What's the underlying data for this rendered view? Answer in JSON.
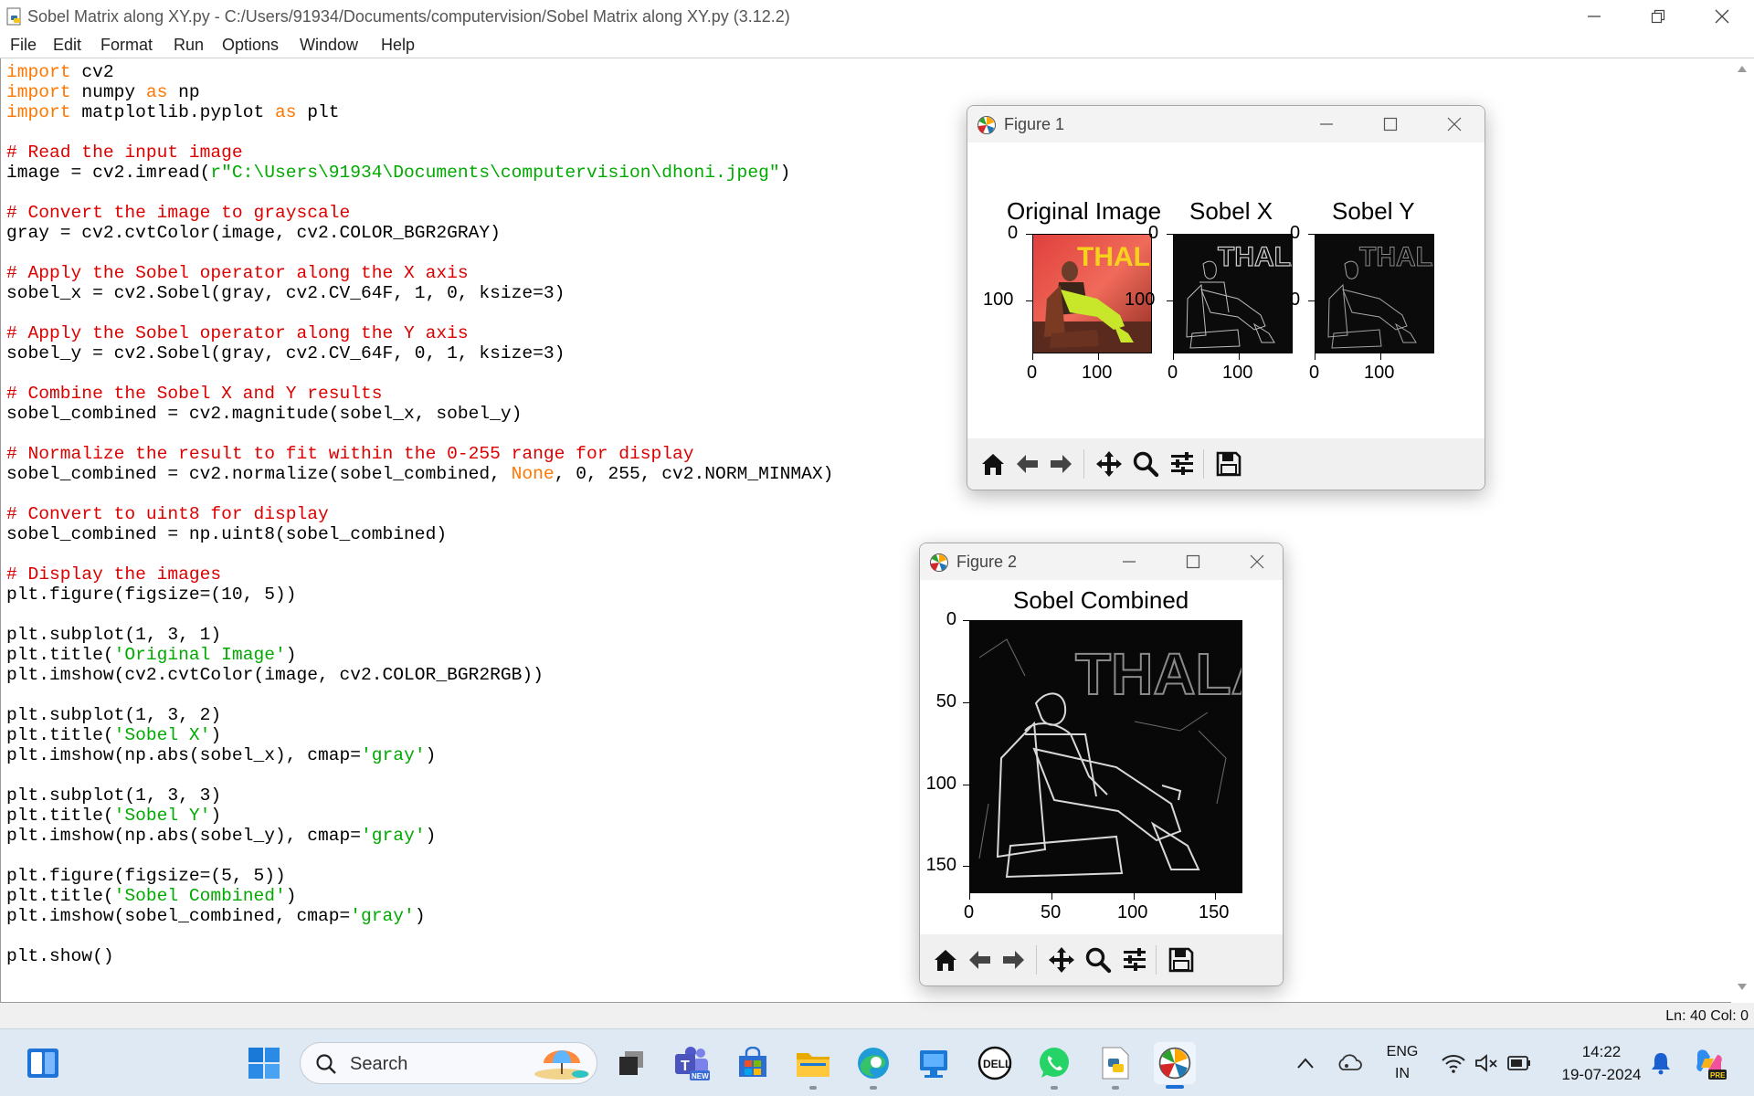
{
  "window": {
    "title": "Sobel Matrix along XY.py - C:/Users/91934/Documents/computervision/Sobel Matrix along XY.py (3.12.2)",
    "icon": "python-file-icon"
  },
  "menu": [
    "File",
    "Edit",
    "Format",
    "Run",
    "Options",
    "Window",
    "Help"
  ],
  "code": [
    [
      [
        "kw",
        "import"
      ],
      [
        "t",
        " cv2"
      ]
    ],
    [
      [
        "kw",
        "import"
      ],
      [
        "t",
        " numpy "
      ],
      [
        "kw",
        "as"
      ],
      [
        "t",
        " np"
      ]
    ],
    [
      [
        "kw",
        "import"
      ],
      [
        "t",
        " matplotlib.pyplot "
      ],
      [
        "kw",
        "as"
      ],
      [
        "t",
        " plt"
      ]
    ],
    [],
    [
      [
        "cm",
        "# Read the input image"
      ]
    ],
    [
      [
        "t",
        "image = cv2.imread("
      ],
      [
        "st",
        "r\"C:\\Users\\91934\\Documents\\computervision\\dhoni.jpeg\""
      ],
      [
        "t",
        ")"
      ]
    ],
    [],
    [
      [
        "cm",
        "# Convert the image to grayscale"
      ]
    ],
    [
      [
        "t",
        "gray = cv2.cvtColor(image, cv2.COLOR_BGR2GRAY)"
      ]
    ],
    [],
    [
      [
        "cm",
        "# Apply the Sobel operator along the X axis"
      ]
    ],
    [
      [
        "t",
        "sobel_x = cv2.Sobel(gray, cv2.CV_64F, 1, 0, ksize=3)"
      ]
    ],
    [],
    [
      [
        "cm",
        "# Apply the Sobel operator along the Y axis"
      ]
    ],
    [
      [
        "t",
        "sobel_y = cv2.Sobel(gray, cv2.CV_64F, 0, 1, ksize=3)"
      ]
    ],
    [],
    [
      [
        "cm",
        "# Combine the Sobel X and Y results"
      ]
    ],
    [
      [
        "t",
        "sobel_combined = cv2.magnitude(sobel_x, sobel_y)"
      ]
    ],
    [],
    [
      [
        "cm",
        "# Normalize the result to fit within the 0-255 range for display"
      ]
    ],
    [
      [
        "t",
        "sobel_combined = cv2.normalize(sobel_combined, "
      ],
      [
        "kw",
        "None"
      ],
      [
        "t",
        ", 0, 255, cv2.NORM_MINMAX)"
      ]
    ],
    [],
    [
      [
        "cm",
        "# Convert to uint8 for display"
      ]
    ],
    [
      [
        "t",
        "sobel_combined = np.uint8(sobel_combined)"
      ]
    ],
    [],
    [
      [
        "cm",
        "# Display the images"
      ]
    ],
    [
      [
        "t",
        "plt.figure(figsize=(10, 5))"
      ]
    ],
    [],
    [
      [
        "t",
        "plt.subplot(1, 3, 1)"
      ]
    ],
    [
      [
        "t",
        "plt.title("
      ],
      [
        "st",
        "'Original Image'"
      ],
      [
        "t",
        ")"
      ]
    ],
    [
      [
        "t",
        "plt.imshow(cv2.cvtColor(image, cv2.COLOR_BGR2RGB))"
      ]
    ],
    [],
    [
      [
        "t",
        "plt.subplot(1, 3, 2)"
      ]
    ],
    [
      [
        "t",
        "plt.title("
      ],
      [
        "st",
        "'Sobel X'"
      ],
      [
        "t",
        ")"
      ]
    ],
    [
      [
        "t",
        "plt.imshow(np.abs(sobel_x), cmap="
      ],
      [
        "st",
        "'gray'"
      ],
      [
        "t",
        ")"
      ]
    ],
    [],
    [
      [
        "t",
        "plt.subplot(1, 3, 3)"
      ]
    ],
    [
      [
        "t",
        "plt.title("
      ],
      [
        "st",
        "'Sobel Y'"
      ],
      [
        "t",
        ")"
      ]
    ],
    [
      [
        "t",
        "plt.imshow(np.abs(sobel_y), cmap="
      ],
      [
        "st",
        "'gray'"
      ],
      [
        "t",
        ")"
      ]
    ],
    [],
    [
      [
        "t",
        "plt.figure(figsize=(5, 5))"
      ]
    ],
    [
      [
        "t",
        "plt.title("
      ],
      [
        "st",
        "'Sobel Combined'"
      ],
      [
        "t",
        ")"
      ]
    ],
    [
      [
        "t",
        "plt.imshow(sobel_combined, cmap="
      ],
      [
        "st",
        "'gray'"
      ],
      [
        "t",
        ")"
      ]
    ],
    [],
    [
      [
        "t",
        "plt.show()"
      ]
    ]
  ],
  "status": "Ln: 40   Col: 0",
  "figure1": {
    "title": "Figure 1",
    "subplots": [
      {
        "title": "Original Image",
        "yticks": [
          "0",
          "100"
        ],
        "xticks": [
          "0",
          "100"
        ],
        "image_text": "THALA"
      },
      {
        "title": "Sobel X",
        "yticks": [
          "0",
          "100"
        ],
        "xticks": [
          "0",
          "100"
        ],
        "image_text": "THALA"
      },
      {
        "title": "Sobel Y",
        "yticks": [
          "0",
          "0"
        ],
        "xticks": [
          "0",
          "100"
        ],
        "image_text": "THALA"
      }
    ]
  },
  "figure2": {
    "title": "Figure 2",
    "axes_title": "Sobel Combined",
    "yticks": [
      "0",
      "50",
      "100",
      "150"
    ],
    "xticks": [
      "0",
      "50",
      "100",
      "150"
    ],
    "image_text": "THALA"
  },
  "toolbar_icons": [
    "home-icon",
    "back-arrow-icon",
    "forward-arrow-icon",
    "pan-icon",
    "zoom-icon",
    "configure-subplots-icon",
    "save-icon"
  ],
  "taskbar": {
    "search_label": "Search",
    "lang_top": "ENG",
    "lang_bottom": "IN",
    "time": "14:22",
    "date": "19-07-2024",
    "new_badge": "NEW",
    "pre_badge": "PRE"
  },
  "colors": {
    "keyword": "#ff7700",
    "comment": "#dd0000",
    "string": "#00aa00",
    "taskbar_bg": "#dfe9f4",
    "accent": "#1a6fd6"
  }
}
